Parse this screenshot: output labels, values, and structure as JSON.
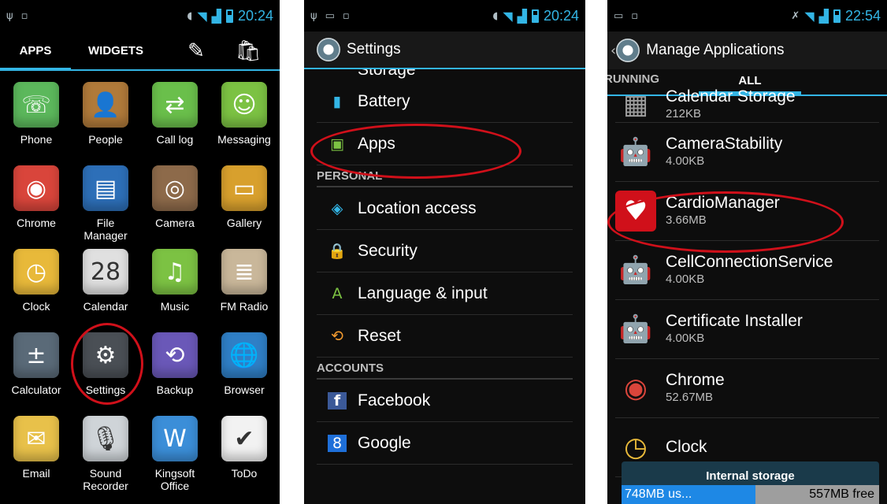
{
  "status": {
    "panel1_time": "20:24",
    "panel2_time": "20:24",
    "panel3_time": "22:54"
  },
  "launcher": {
    "tabs": [
      "APPS",
      "WIDGETS"
    ],
    "apps": [
      {
        "label": "Phone",
        "icon": "phone-icon",
        "glyph": "☏",
        "color": "#5cb85c"
      },
      {
        "label": "People",
        "icon": "people-icon",
        "glyph": "👤",
        "color": "#b07a3a"
      },
      {
        "label": "Call log",
        "icon": "call-log-icon",
        "glyph": "⇄",
        "color": "#6abf4b"
      },
      {
        "label": "Messaging",
        "icon": "messaging-icon",
        "glyph": "☺",
        "color": "#7cc243"
      },
      {
        "label": "Chrome",
        "icon": "chrome-icon",
        "glyph": "◉",
        "color": "#d9453b"
      },
      {
        "label": "File\nManager",
        "icon": "file-manager-icon",
        "glyph": "▤",
        "color": "#2d6fb8"
      },
      {
        "label": "Camera",
        "icon": "camera-icon",
        "glyph": "◎",
        "color": "#8d6a4a"
      },
      {
        "label": "Gallery",
        "icon": "gallery-icon",
        "glyph": "▭",
        "color": "#d8a02d"
      },
      {
        "label": "Clock",
        "icon": "clock-icon",
        "glyph": "◷",
        "color": "#e8b93a"
      },
      {
        "label": "Calendar",
        "icon": "calendar-icon",
        "glyph": "28",
        "color": "#e0e0e0"
      },
      {
        "label": "Music",
        "icon": "music-icon",
        "glyph": "♫",
        "color": "#7cc243"
      },
      {
        "label": "FM Radio",
        "icon": "fm-radio-icon",
        "glyph": "≣",
        "color": "#c9b79a"
      },
      {
        "label": "Calculator",
        "icon": "calculator-icon",
        "glyph": "±",
        "color": "#5a6a78"
      },
      {
        "label": "Settings",
        "icon": "settings-icon",
        "glyph": "⚙",
        "color": "#4a4f55"
      },
      {
        "label": "Backup",
        "icon": "backup-icon",
        "glyph": "⟲",
        "color": "#6a58b8"
      },
      {
        "label": "Browser",
        "icon": "browser-icon",
        "glyph": "🌐",
        "color": "#2f7fc6"
      },
      {
        "label": "Email",
        "icon": "email-icon",
        "glyph": "✉",
        "color": "#e8c14a"
      },
      {
        "label": "Sound\nRecorder",
        "icon": "sound-recorder-icon",
        "glyph": "🎙",
        "color": "#cfd4d8"
      },
      {
        "label": "Kingsoft\nOffice",
        "icon": "kingsoft-office-icon",
        "glyph": "W",
        "color": "#3b8ed8"
      },
      {
        "label": "ToDo",
        "icon": "todo-icon",
        "glyph": "✔",
        "color": "#f2f2f2"
      }
    ]
  },
  "settings": {
    "title": "Settings",
    "cut_top": "Storage",
    "rows1": [
      {
        "label": "Battery",
        "icon": "battery-icon",
        "glyph": "▮"
      },
      {
        "label": "Apps",
        "icon": "apps-icon",
        "glyph": "▣"
      }
    ],
    "section_personal": "PERSONAL",
    "rows2": [
      {
        "label": "Location access",
        "icon": "location-icon",
        "glyph": "◈"
      },
      {
        "label": "Security",
        "icon": "lock-icon",
        "glyph": "🔒"
      },
      {
        "label": "Language & input",
        "icon": "language-icon",
        "glyph": "A"
      },
      {
        "label": "Reset",
        "icon": "reset-icon",
        "glyph": "⟲"
      }
    ],
    "section_accounts": "ACCOUNTS",
    "rows3": [
      {
        "label": "Facebook",
        "icon": "facebook-icon",
        "glyph": "f"
      },
      {
        "label": "Google",
        "icon": "google-icon",
        "glyph": "8"
      }
    ]
  },
  "manage": {
    "title": "Manage Applications",
    "tabs": [
      "RUNNING",
      "ALL"
    ],
    "items": [
      {
        "name": "Calendar Storage",
        "size": "212KB",
        "icon": "calendar-storage-icon",
        "glyph": "▦"
      },
      {
        "name": "CameraStability",
        "size": "4.00KB",
        "icon": "android-icon",
        "glyph": "🤖"
      },
      {
        "name": "CardioManager",
        "size": "3.66MB",
        "icon": "heart-icon",
        "glyph": "♥"
      },
      {
        "name": "CellConnectionService",
        "size": "4.00KB",
        "icon": "android-icon",
        "glyph": "🤖"
      },
      {
        "name": "Certificate Installer",
        "size": "4.00KB",
        "icon": "android-icon",
        "glyph": "🤖"
      },
      {
        "name": "Chrome",
        "size": "52.67MB",
        "icon": "chrome-icon",
        "glyph": "◉"
      },
      {
        "name": "Clock",
        "size": "",
        "icon": "clock-icon",
        "glyph": "◷"
      }
    ],
    "storage": {
      "title": "Internal storage",
      "used": "748MB us...",
      "free": "557MB free"
    }
  }
}
